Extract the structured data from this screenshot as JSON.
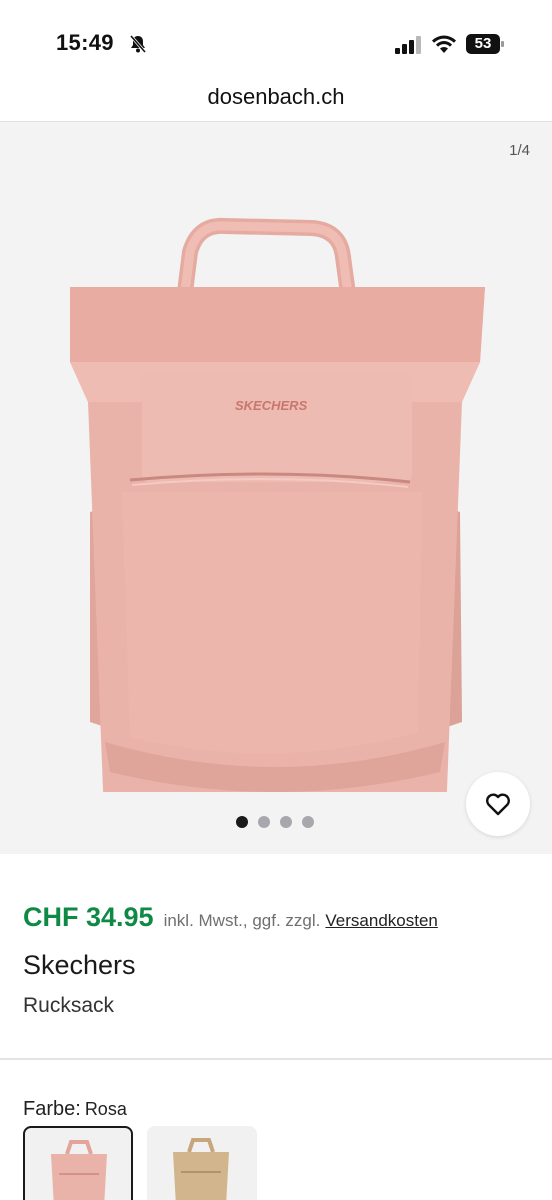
{
  "status_bar": {
    "time": "15:49",
    "battery": "53"
  },
  "browser": {
    "url": "dosenbach.ch"
  },
  "gallery": {
    "counter": "1/4",
    "total_images": 4,
    "active_index": 0
  },
  "product": {
    "price": "CHF 34.95",
    "price_note": "inkl. Mwst., ggf. zzgl.",
    "shipping_link": "Versandkosten",
    "brand": "Skechers",
    "type": "Rucksack",
    "image_logo": "SKECHERS"
  },
  "color": {
    "label": "Farbe:",
    "value": "Rosa",
    "swatches": [
      "Rosa",
      "Beige"
    ]
  },
  "colors": {
    "price_green": "#0e8a45",
    "bag_pink": "#eab3aa",
    "bag_beige": "#d2b58d"
  },
  "icons": {
    "favorite": "heart-icon",
    "mute": "bell-slash-icon",
    "signal": "cellular-signal-icon",
    "wifi": "wifi-icon",
    "battery": "battery-icon"
  }
}
